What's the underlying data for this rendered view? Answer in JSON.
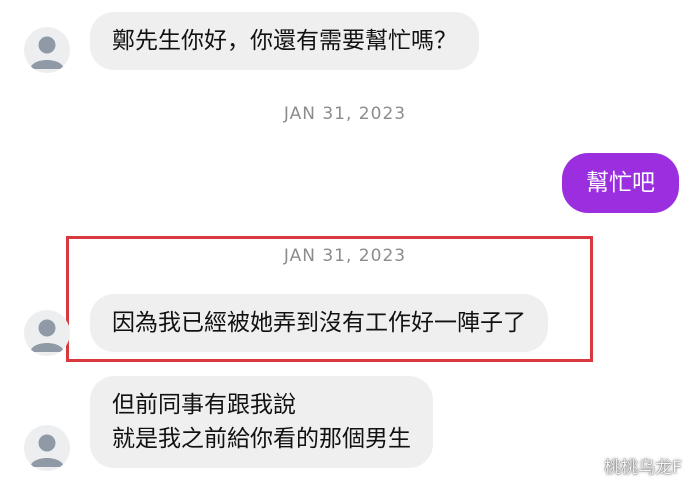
{
  "messages": {
    "m1": {
      "text": "鄭先生你好，你還有需要幫忙嗎？"
    },
    "ts1": {
      "text": "JAN 31, 2023"
    },
    "m2": {
      "text": "幫忙吧"
    },
    "ts2": {
      "text": "JAN 31, 2023"
    },
    "m3": {
      "text": "因為我已經被她弄到沒有工作好一陣子了"
    },
    "m4": {
      "line1": "但前同事有跟我說",
      "line2": "就是我之前給你看的那個男生"
    }
  },
  "watermark": {
    "text": "桃桃乌龙F"
  },
  "colors": {
    "incoming_bubble": "#efefef",
    "outgoing_bubble": "#9b2fe0",
    "highlight_border": "#d8393e",
    "timestamp_text": "#8c8c8c"
  }
}
